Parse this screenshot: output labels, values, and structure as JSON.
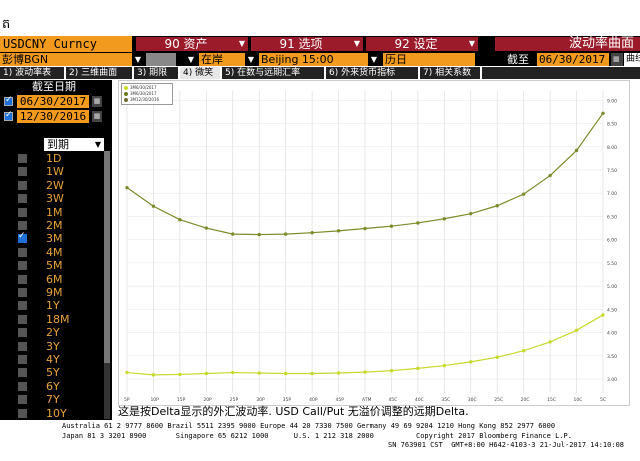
{
  "top_glyph": "ត",
  "header": {
    "ticker": "USDCNY Curncy",
    "menus": [
      {
        "label": "90 资产"
      },
      {
        "label": "91 选项"
      },
      {
        "label": "92 设定"
      }
    ],
    "title": "波动率曲面"
  },
  "controls": {
    "source": "彭博BGN",
    "market": "在岸",
    "time": "Beijing 15:00",
    "calendar": "历日",
    "asof_label": "截至",
    "asof_date": "06/30/2017",
    "icon_label": "曲线"
  },
  "tabs": [
    {
      "label": "1) 波动率表"
    },
    {
      "label": "2) 三维曲面"
    },
    {
      "label": "3) 期限"
    },
    {
      "label": "4) 微笑"
    },
    {
      "label": "5) 在数与远期汇率"
    },
    {
      "label": "6) 外来货币指标"
    },
    {
      "label": "7) 相关系数"
    }
  ],
  "left_panel": {
    "asof_header": "截至日期",
    "dates": [
      "06/30/2017",
      "12/30/2016"
    ],
    "tenor_header": "到期",
    "tenors": [
      {
        "label": "1D",
        "checked": false
      },
      {
        "label": "1W",
        "checked": false
      },
      {
        "label": "2W",
        "checked": false
      },
      {
        "label": "3W",
        "checked": false
      },
      {
        "label": "1M",
        "checked": false
      },
      {
        "label": "2M",
        "checked": false
      },
      {
        "label": "3M",
        "checked": true
      },
      {
        "label": "4M",
        "checked": false
      },
      {
        "label": "5M",
        "checked": false
      },
      {
        "label": "6M",
        "checked": false
      },
      {
        "label": "9M",
        "checked": false
      },
      {
        "label": "1Y",
        "checked": false
      },
      {
        "label": "18M",
        "checked": false
      },
      {
        "label": "2Y",
        "checked": false
      },
      {
        "label": "3Y",
        "checked": false
      },
      {
        "label": "4Y",
        "checked": false
      },
      {
        "label": "5Y",
        "checked": false
      },
      {
        "label": "6Y",
        "checked": false
      },
      {
        "label": "7Y",
        "checked": false
      },
      {
        "label": "10Y",
        "checked": false
      }
    ]
  },
  "legend": [
    {
      "label": "3M6/30/2017",
      "color": "#c7d92a"
    },
    {
      "label": "3M6/30/2017",
      "color": "#6b7a1f"
    },
    {
      "label": "3M12/30/2016",
      "color": "#6b6b2a"
    }
  ],
  "chart_data": {
    "type": "line",
    "x": [
      "5P",
      "10P",
      "15P",
      "20P",
      "25P",
      "30P",
      "35P",
      "40P",
      "45P",
      "ATM",
      "45C",
      "40C",
      "35C",
      "30C",
      "25C",
      "20C",
      "15C",
      "10C",
      "5C"
    ],
    "series": [
      {
        "values": [
          7.12,
          6.72,
          6.43,
          6.25,
          6.12,
          6.11,
          6.12,
          6.15,
          6.19,
          6.24,
          6.29,
          6.36,
          6.45,
          6.56,
          6.73,
          6.98,
          7.38,
          7.92,
          8.72
        ]
      },
      {
        "values": [
          3.14,
          3.09,
          3.1,
          3.12,
          3.14,
          3.13,
          3.12,
          3.12,
          3.13,
          3.15,
          3.18,
          3.23,
          3.29,
          3.37,
          3.47,
          3.61,
          3.8,
          4.05,
          4.38
        ]
      }
    ],
    "series_colors": [
      "#7d8a2b",
      "#c7d92a"
    ],
    "ylim": [
      2.7,
      9.2
    ],
    "yticks": [
      3.0,
      3.5,
      4.0,
      4.5,
      5.0,
      5.5,
      6.0,
      6.5,
      7.0,
      7.5,
      8.0,
      8.5,
      9.0
    ],
    "grid": true
  },
  "footnote": "这是按Delta显示的外汇波动率. USD Call/Put 无溢价调整的远期Delta.",
  "footer": {
    "line1": "Australia 61 2 9777 8600 Brazil 5511 2395 9000 Europe 44 20 7330 7500 Germany 49 69 9204 1210 Hong Kong 852 2977 6000",
    "line2": "Japan 81 3 3201 8900       Singapore 65 6212 1000      U.S. 1 212 318 2000          Copyright 2017 Bloomberg Finance L.P.",
    "line3": "SN 763901 CST  GMT+8:00 H642-4103-3 21-Jul-2017 14:10:08"
  }
}
